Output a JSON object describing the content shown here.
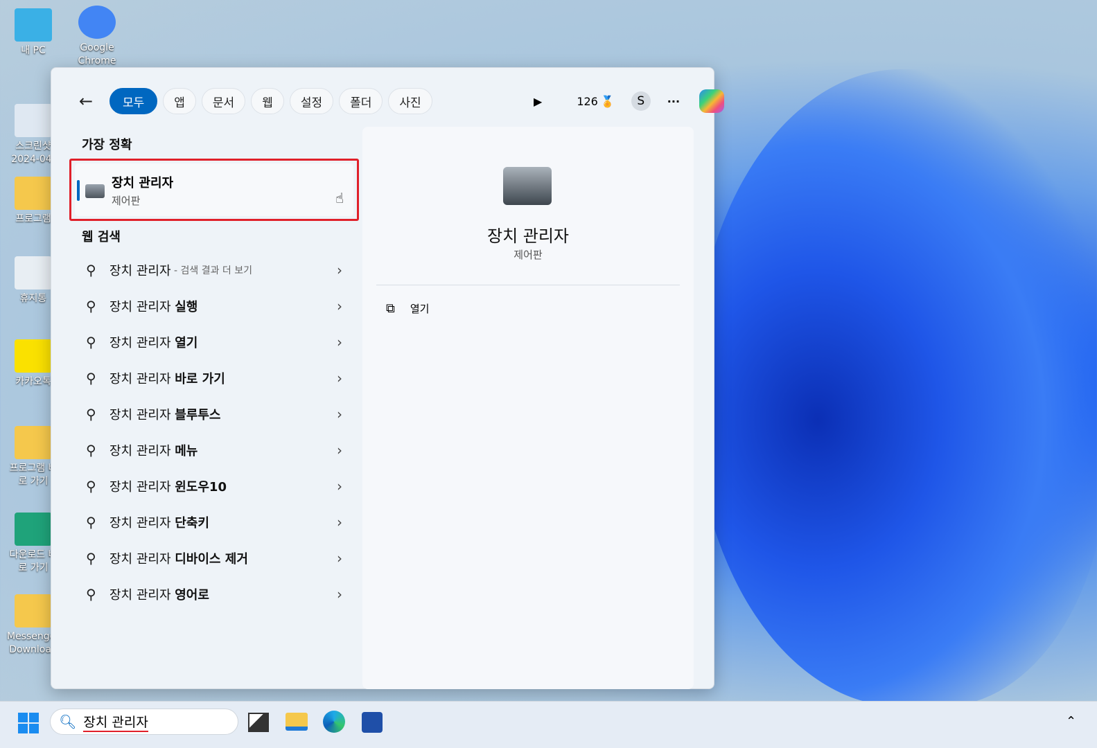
{
  "desktop": {
    "icons": [
      {
        "label": "내 PC",
        "color": "#3ab0e6"
      },
      {
        "label": "Google Chrome",
        "color": "#4285f4"
      },
      {
        "label": "스크린샷 2024-04-",
        "color": "#dfe8f2"
      },
      {
        "label": "프로그램",
        "color": "#f5c84c"
      },
      {
        "label": "휴지통",
        "color": "#e8eef3"
      },
      {
        "label": "카카오톡",
        "color": "#fae100"
      },
      {
        "label": "프로그램 바로 가기",
        "color": "#f5c84c"
      },
      {
        "label": "다운로드 바로 가기",
        "color": "#1fa37a"
      },
      {
        "label": "Messenger Download",
        "color": "#f5c84c"
      }
    ]
  },
  "search_panel": {
    "filters": [
      "모두",
      "앱",
      "문서",
      "웹",
      "설정",
      "폴더",
      "사진"
    ],
    "active_filter": "모두",
    "points": "126",
    "avatar": "S",
    "more": "···",
    "best_match": {
      "heading": "가장 정확",
      "title": "장치 관리자",
      "subtitle": "제어판"
    },
    "web_search": {
      "heading": "웹 검색",
      "items": [
        {
          "prefix": "장치 관리자",
          "suffix": " - 검색 결과 더 보기",
          "bold": false
        },
        {
          "prefix": "장치 관리자 ",
          "suffix": "실행",
          "bold": true
        },
        {
          "prefix": "장치 관리자 ",
          "suffix": "열기",
          "bold": true
        },
        {
          "prefix": "장치 관리자 ",
          "suffix": "바로 가기",
          "bold": true
        },
        {
          "prefix": "장치 관리자 ",
          "suffix": "블루투스",
          "bold": true
        },
        {
          "prefix": "장치 관리자 ",
          "suffix": "메뉴",
          "bold": true
        },
        {
          "prefix": "장치 관리자 ",
          "suffix": "윈도우10",
          "bold": true
        },
        {
          "prefix": "장치 관리자 ",
          "suffix": "단축키",
          "bold": true
        },
        {
          "prefix": "장치 관리자 ",
          "suffix": "디바이스 제거",
          "bold": true
        },
        {
          "prefix": "장치 관리자 ",
          "suffix": "영어로",
          "bold": true
        }
      ]
    },
    "detail": {
      "title": "장치 관리자",
      "subtitle": "제어판",
      "actions": [
        {
          "label": "열기",
          "icon": "open-external-icon"
        }
      ]
    }
  },
  "taskbar": {
    "search_value": "장치 관리자",
    "accent": "#0067c0"
  }
}
